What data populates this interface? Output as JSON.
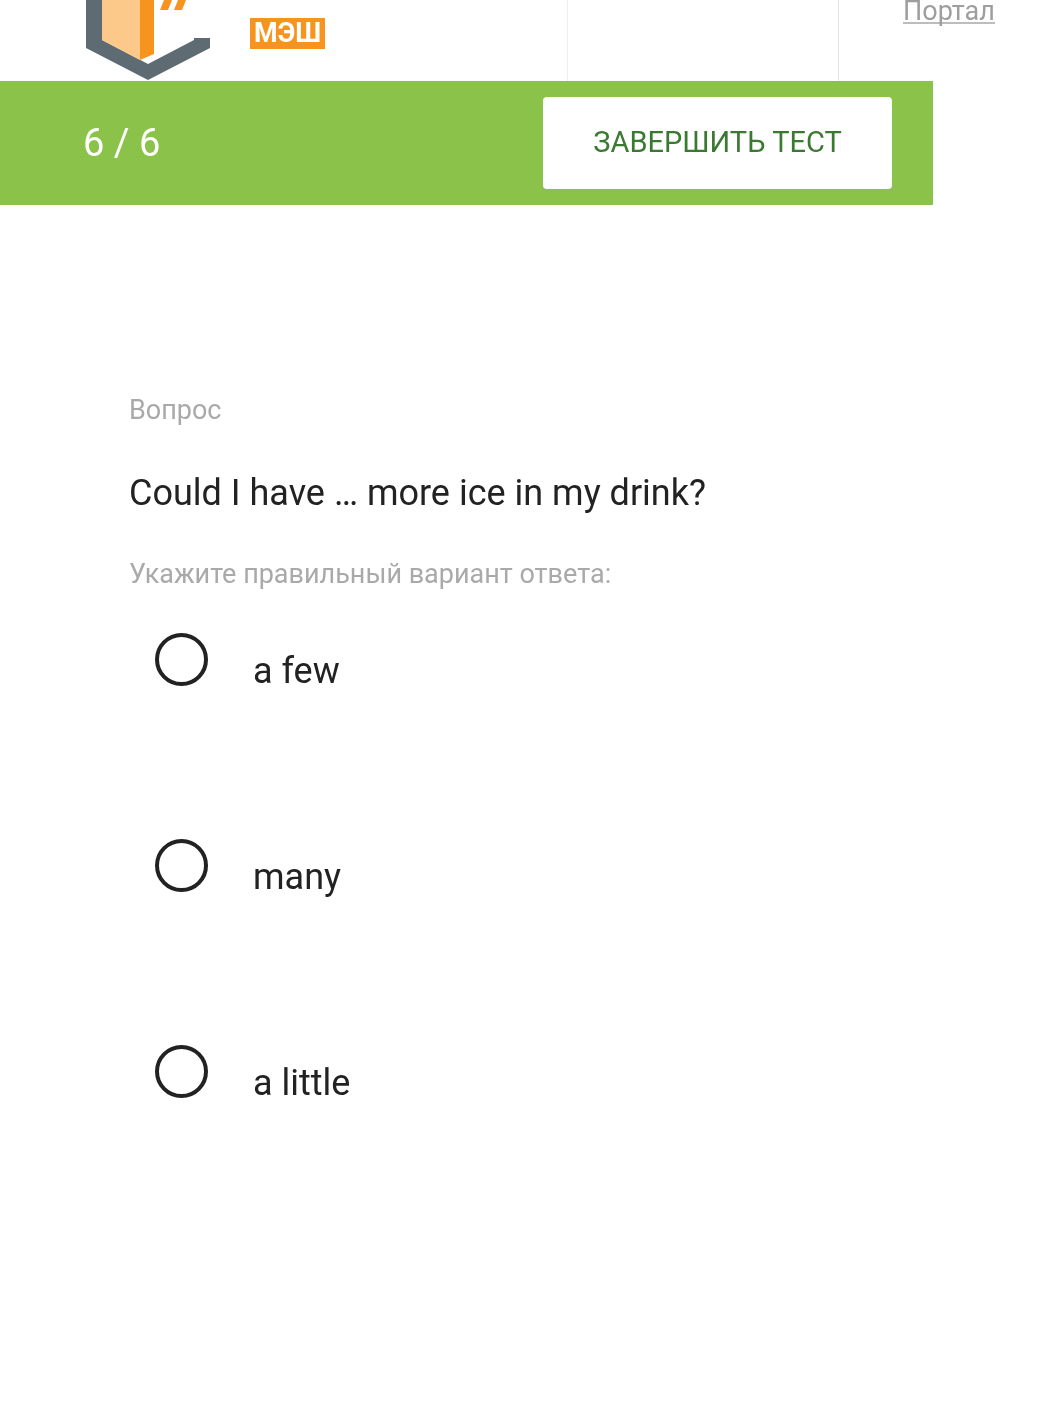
{
  "header": {
    "logo_badge": "МЭШ",
    "portal_link": "Портал"
  },
  "progress": {
    "counter": "6 / 6",
    "finish_button": "ЗАВЕРШИТЬ ТЕСТ"
  },
  "question": {
    "label": "Вопрос",
    "text": "Could I have … more ice in my drink?",
    "instruction": "Укажите правильный вариант ответа:"
  },
  "options": [
    {
      "label": "a few",
      "selected": false
    },
    {
      "label": "many",
      "selected": false
    },
    {
      "label": "a little",
      "selected": false
    }
  ]
}
